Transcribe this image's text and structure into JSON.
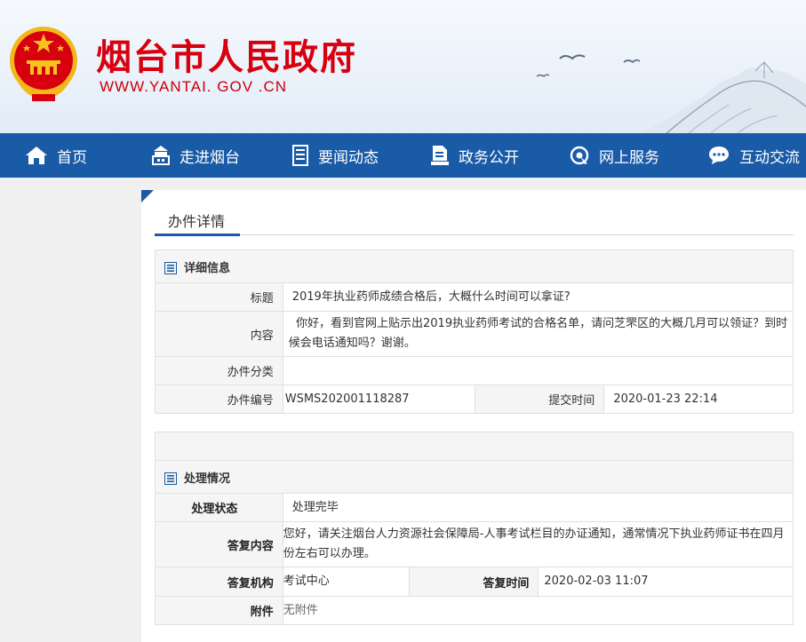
{
  "site": {
    "title": "烟台市人民政府",
    "url": "WWW.YANTAI. GOV .CN"
  },
  "nav": [
    {
      "label": "首页",
      "icon": "home-icon"
    },
    {
      "label": "走进烟台",
      "icon": "building-icon"
    },
    {
      "label": "要闻动态",
      "icon": "news-icon"
    },
    {
      "label": "政务公开",
      "icon": "document-icon"
    },
    {
      "label": "网上服务",
      "icon": "service-icon"
    },
    {
      "label": "互动交流",
      "icon": "chat-icon"
    }
  ],
  "page": {
    "tab_title": "办件详情"
  },
  "detail": {
    "section_title": "详细信息",
    "title_label": "标题",
    "title_value": "2019年执业药师成绩合格后，大概什么时间可以拿证?",
    "content_label": "内容",
    "content_value": "  你好，看到官网上贴示出2019执业药师考试的合格名单，请问芝罘区的大概几月可以领证？到时候会电话通知吗？谢谢。",
    "category_label": "办件分类",
    "category_value": "",
    "number_label": "办件编号",
    "number_value": "WSMS202001118287",
    "submit_label": "提交时间",
    "submit_value": "2020-01-23 22:14"
  },
  "handling": {
    "section_title": "处理情况",
    "status_label": "处理状态",
    "status_value": "处理完毕",
    "reply_label": "答复内容",
    "reply_value": "您好，请关注烟台人力资源社会保障局-人事考试栏目的办证通知，通常情况下执业药师证书在四月份左右可以办理。",
    "org_label": "答复机构",
    "org_value": "考试中心",
    "time_label": "答复时间",
    "time_value": "2020-02-03 11:07",
    "attach_label": "附件",
    "attach_value": "无附件"
  },
  "colors": {
    "nav_bg": "#1a5ba7",
    "title_red": "#d7000f"
  }
}
